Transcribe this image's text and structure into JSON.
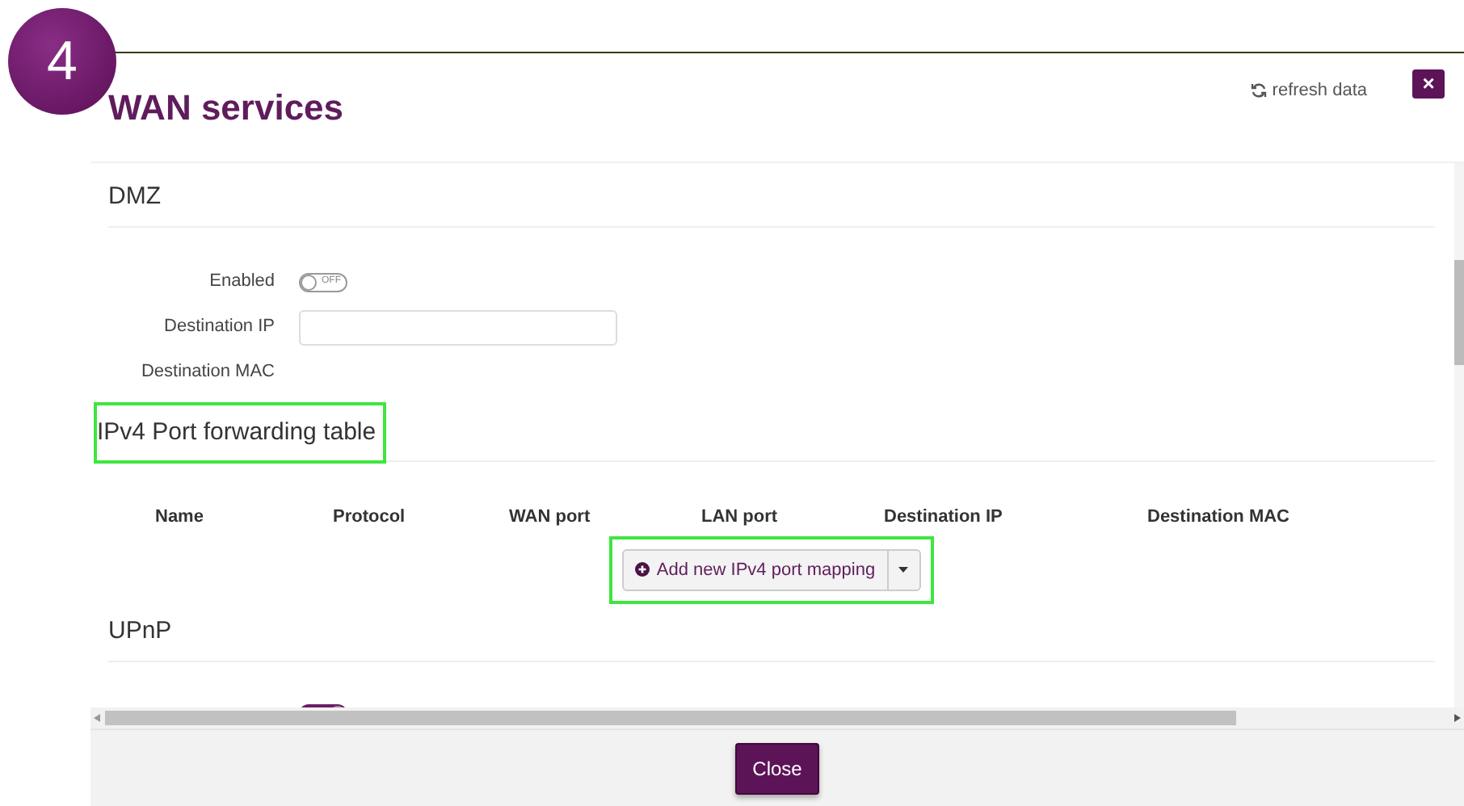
{
  "step_badge": "4",
  "dialog": {
    "title": "WAN services",
    "close_icon": "×",
    "refresh_label": "refresh data"
  },
  "dmz": {
    "heading": "DMZ",
    "fields": [
      {
        "kind": "toggle",
        "label": "Enabled",
        "on": false,
        "toggle_text": "OFF"
      },
      {
        "kind": "input",
        "label": "Destination IP"
      },
      {
        "kind": "text",
        "label": "Destination MAC"
      }
    ]
  },
  "port_forwarding": {
    "heading": "IPv4 Port forwarding table",
    "highlighted": true,
    "columns": [
      "Name",
      "Protocol",
      "WAN port",
      "LAN port",
      "Destination IP",
      "Destination MAC"
    ],
    "add_button": {
      "label": "Add new IPv4 port mapping",
      "highlighted": true
    }
  },
  "upnp": {
    "heading": "UPnP",
    "toggle_on": true
  },
  "footer": {
    "close_button": "Close"
  }
}
